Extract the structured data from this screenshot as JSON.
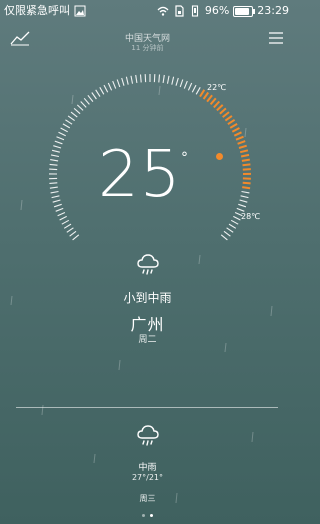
{
  "status_bar": {
    "emergency_text": "仅限紧急呼叫",
    "battery": "96%",
    "time": "23:29",
    "icons": [
      "image-icon",
      "wifi-icon",
      "sim-icon",
      "vibrate-icon",
      "battery-icon"
    ]
  },
  "header": {
    "source": "中国天气网",
    "updated": "11 分钟前"
  },
  "current": {
    "temperature": "25",
    "degree_symbol": "°",
    "high_label": "22℃",
    "low_label": "28℃",
    "condition": "小到中雨",
    "city": "广州",
    "weekday": "周二"
  },
  "forecast": {
    "condition": "中雨",
    "range": "27°/21°",
    "weekday": "周三"
  },
  "pager": {
    "count": 2,
    "active_index": 1
  },
  "colors": {
    "accent": "#f28a2b",
    "background_top": "#5f7b7d",
    "background_bottom": "#3f615f"
  }
}
